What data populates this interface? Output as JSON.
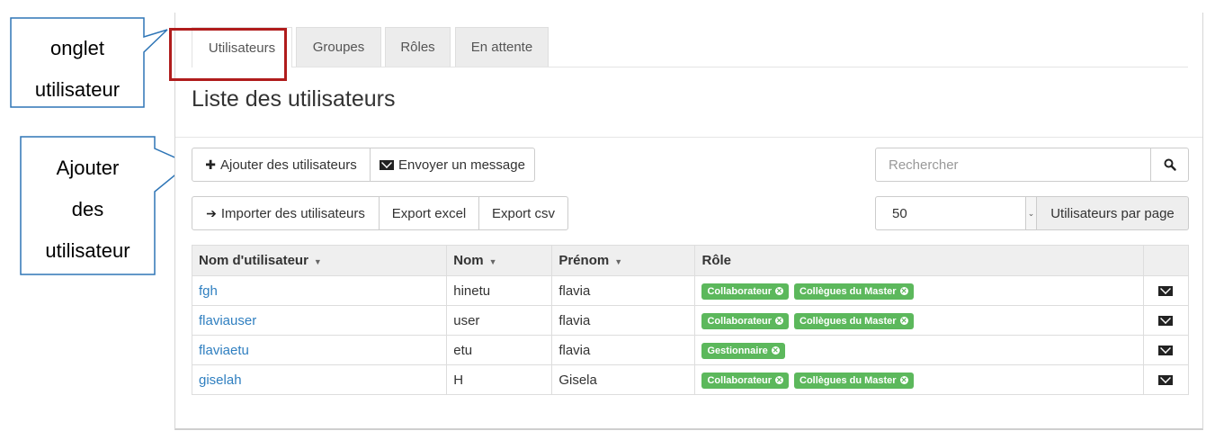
{
  "annotations": {
    "tab_callout": [
      "onglet",
      "utilisateur"
    ],
    "add_callout": [
      "Ajouter",
      "des",
      "utilisateur"
    ]
  },
  "tabs": [
    {
      "label": "Utilisateurs",
      "active": true
    },
    {
      "label": "Groupes",
      "active": false
    },
    {
      "label": "Rôles",
      "active": false
    },
    {
      "label": "En attente",
      "active": false
    }
  ],
  "page_title": "Liste des utilisateurs",
  "toolbar": {
    "add_users": "Ajouter des utilisateurs",
    "send_message": "Envoyer un message",
    "import_users": "Importer des utilisateurs",
    "export_excel": "Export excel",
    "export_csv": "Export csv"
  },
  "search": {
    "placeholder": "Rechercher"
  },
  "pagination": {
    "per_page_value": "50",
    "per_page_label": "Utilisateurs par page"
  },
  "table": {
    "columns": [
      "Nom d'utilisateur",
      "Nom",
      "Prénom",
      "Rôle"
    ],
    "rows": [
      {
        "username": "fgh",
        "nom": "hinetu",
        "prenom": "flavia",
        "roles": [
          "Collaborateur",
          "Collègues du Master"
        ]
      },
      {
        "username": "flaviauser",
        "nom": "user",
        "prenom": "flavia",
        "roles": [
          "Collaborateur",
          "Collègues du Master"
        ]
      },
      {
        "username": "flaviaetu",
        "nom": "etu",
        "prenom": "flavia",
        "roles": [
          "Gestionnaire"
        ]
      },
      {
        "username": "giselah",
        "nom": "H",
        "prenom": "Gisela",
        "roles": [
          "Collaborateur",
          "Collègues du Master"
        ]
      }
    ]
  },
  "colors": {
    "accent_link": "#2f7fc0",
    "role_badge": "#5cb85c",
    "highlight": "#b01c1c",
    "callout_border": "#2e75b6"
  }
}
